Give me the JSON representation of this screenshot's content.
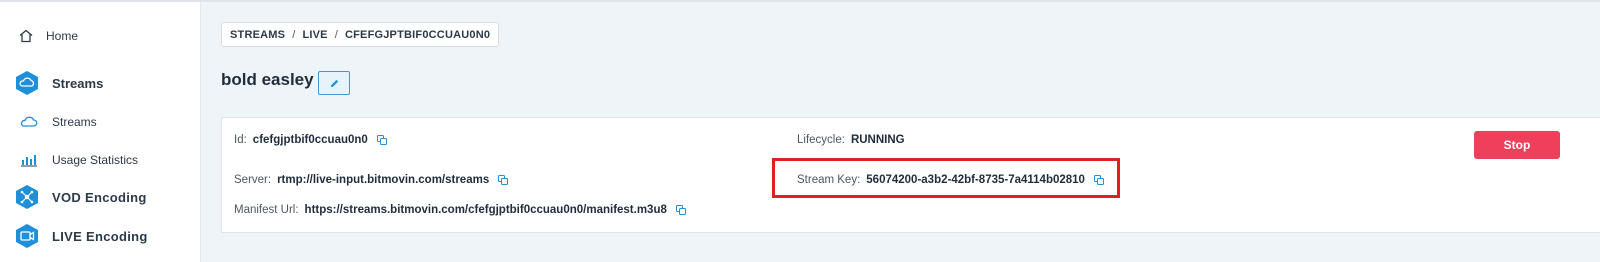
{
  "sidebar": {
    "home": "Home",
    "streams_header": "Streams",
    "streams_item": "Streams",
    "usage": "Usage Statistics",
    "vod": "VOD Encoding",
    "live": "LIVE Encoding"
  },
  "breadcrumb": {
    "items": [
      "STREAMS",
      "LIVE",
      "CFEFGJPTBIF0CCUAU0N0"
    ],
    "separator": "/"
  },
  "stream": {
    "name": "bold easley",
    "id_label": "Id:",
    "id_value": "cfefgjptbif0ccuau0n0",
    "lifecycle_label": "Lifecycle:",
    "lifecycle_value": "RUNNING",
    "server_label": "Server:",
    "server_value": "rtmp://live-input.bitmovin.com/streams",
    "stream_key_label": "Stream Key:",
    "stream_key_value": "56074200-a3b2-42bf-8735-7a4114b02810",
    "manifest_label": "Manifest Url:",
    "manifest_value": "https://streams.bitmovin.com/cfefgjptbif0ccuau0n0/manifest.m3u8",
    "stop_label": "Stop"
  },
  "colors": {
    "accent": "#1e8fd8",
    "danger": "#ef3f5a",
    "highlight": "#e02020"
  }
}
